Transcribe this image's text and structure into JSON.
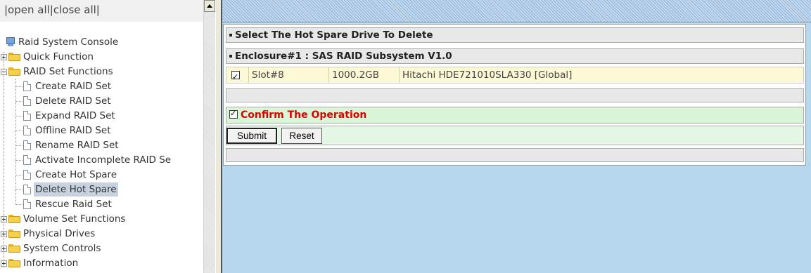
{
  "tree_toolbar": {
    "open_all": "|open all",
    "close_all": "|close all|"
  },
  "tree": {
    "root": "Raid System Console",
    "items": [
      {
        "label": "Quick Function",
        "type": "folder",
        "expanded": false
      },
      {
        "label": "RAID Set Functions",
        "type": "folder",
        "expanded": true,
        "children": [
          "Create RAID Set",
          "Delete RAID Set",
          "Expand RAID Set",
          "Offline RAID Set",
          "Rename RAID Set",
          "Activate Incomplete RAID Se",
          "Create Hot Spare",
          "Delete Hot Spare",
          "Rescue Raid Set"
        ],
        "selected_child": "Delete Hot Spare"
      },
      {
        "label": "Volume Set Functions",
        "type": "folder",
        "expanded": false
      },
      {
        "label": "Physical Drives",
        "type": "folder",
        "expanded": false
      },
      {
        "label": "System Controls",
        "type": "folder",
        "expanded": false
      },
      {
        "label": "Information",
        "type": "folder",
        "expanded": false
      }
    ]
  },
  "form": {
    "title": "Select The Hot Spare Drive To Delete",
    "enclosure": "Enclosure#1 : SAS RAID Subsystem V1.0",
    "drives": [
      {
        "checked": true,
        "slot": "Slot#8",
        "size": "1000.2GB",
        "model": "Hitachi HDE721010SLA330 [Global]"
      }
    ],
    "confirm_checked": true,
    "confirm_label": "Confirm The Operation",
    "submit_label": "Submit",
    "reset_label": "Reset"
  },
  "colors": {
    "content_bg": "#b6d7ec",
    "confirm_text": "#e00000",
    "drive_row_bg": "#fdf8d6",
    "confirm_row_bg": "#d8f5d8"
  }
}
